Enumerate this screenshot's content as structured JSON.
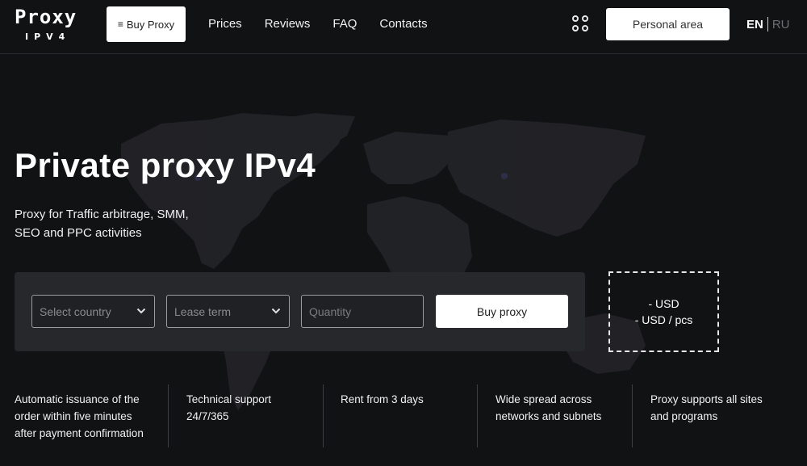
{
  "header": {
    "logo": {
      "word": "Proxy",
      "sub": "IPV4"
    },
    "buy_button": {
      "icon": "menu-icon",
      "label": "Buy Proxy"
    },
    "nav": [
      {
        "label": "Prices"
      },
      {
        "label": "Reviews"
      },
      {
        "label": "FAQ"
      },
      {
        "label": "Contacts"
      }
    ],
    "apps_icon": "grid-icon",
    "personal_area": "Personal area",
    "languages": {
      "active": "EN",
      "inactive": "RU"
    }
  },
  "hero": {
    "title": "Private proxy IPv4",
    "subtitle_line1": "Proxy for Traffic arbitrage, SMM,",
    "subtitle_line2": "SEO and PPC activities"
  },
  "order_form": {
    "country_select": {
      "placeholder": "Select country",
      "icon": "chevron-down-icon"
    },
    "lease_select": {
      "placeholder": "Lease term",
      "icon": "chevron-down-icon"
    },
    "quantity_input": {
      "placeholder": "Quantity",
      "value": ""
    },
    "submit": "Buy proxy"
  },
  "price": {
    "total": "- USD",
    "per_piece": "- USD / pcs"
  },
  "features": [
    {
      "lines": [
        "Automatic issuance of the",
        "order within five minutes",
        "after payment confirmation"
      ]
    },
    {
      "lines": [
        "Technical support",
        "24/7/365"
      ]
    },
    {
      "lines": [
        "Rent from 3 days"
      ]
    },
    {
      "lines": [
        "Wide spread across",
        "networks and subnets"
      ]
    },
    {
      "lines": [
        "Proxy supports all sites",
        "and programs"
      ]
    }
  ],
  "colors": {
    "background": "#111214",
    "panel": "#27282b",
    "button": "#ffffff",
    "map": "#26272b"
  }
}
